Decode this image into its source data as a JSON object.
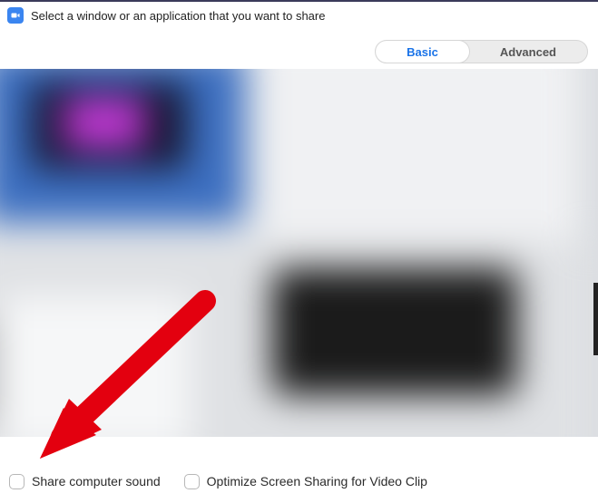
{
  "titlebar": {
    "title": "Select a window or an application that you want to share"
  },
  "tabs": {
    "basic": "Basic",
    "advanced": "Advanced"
  },
  "options": {
    "share_sound": "Share computer sound",
    "optimize_video": "Optimize Screen Sharing for Video Clip"
  }
}
